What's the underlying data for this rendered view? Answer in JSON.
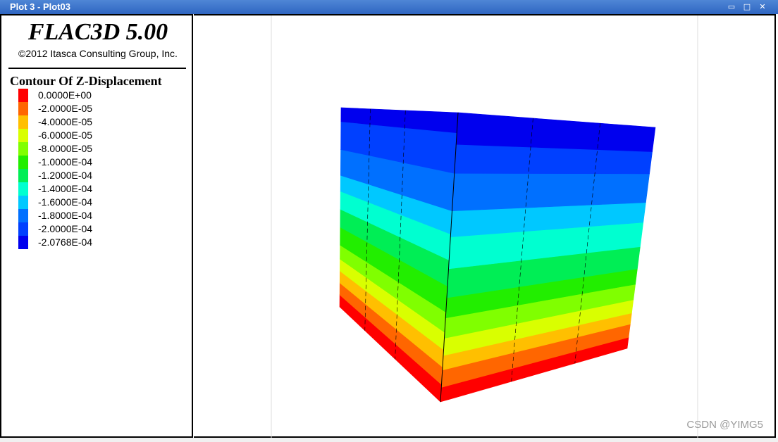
{
  "window": {
    "title": "Plot 3 - Plot03",
    "controls": [
      {
        "name": "minimize",
        "glyph": "▭"
      },
      {
        "name": "maximize",
        "glyph": "□"
      },
      {
        "name": "close",
        "glyph": "✕"
      }
    ]
  },
  "legend": {
    "app_title": "FLAC3D 5.00",
    "copyright": "©2012 Itasca Consulting Group, Inc.",
    "contour_title": "Contour Of Z-Displacement",
    "items": [
      {
        "label": "0.0000E+00",
        "color": "#ff0000"
      },
      {
        "label": "-2.0000E-05",
        "color": "#ff6600"
      },
      {
        "label": "-4.0000E-05",
        "color": "#ffbf00"
      },
      {
        "label": "-6.0000E-05",
        "color": "#d9ff00"
      },
      {
        "label": "-8.0000E-05",
        "color": "#80ff00"
      },
      {
        "label": "-1.0000E-04",
        "color": "#22ee00"
      },
      {
        "label": "-1.2000E-04",
        "color": "#00ee55"
      },
      {
        "label": "-1.4000E-04",
        "color": "#00ffd0"
      },
      {
        "label": "-1.6000E-04",
        "color": "#00c8ff"
      },
      {
        "label": "-1.8000E-04",
        "color": "#0070ff"
      },
      {
        "label": "-2.0000E-04",
        "color": "#0040ff"
      },
      {
        "label": "-2.0768E-04",
        "color": "#0000ee"
      }
    ]
  },
  "watermark": "CSDN @YIMG5"
}
